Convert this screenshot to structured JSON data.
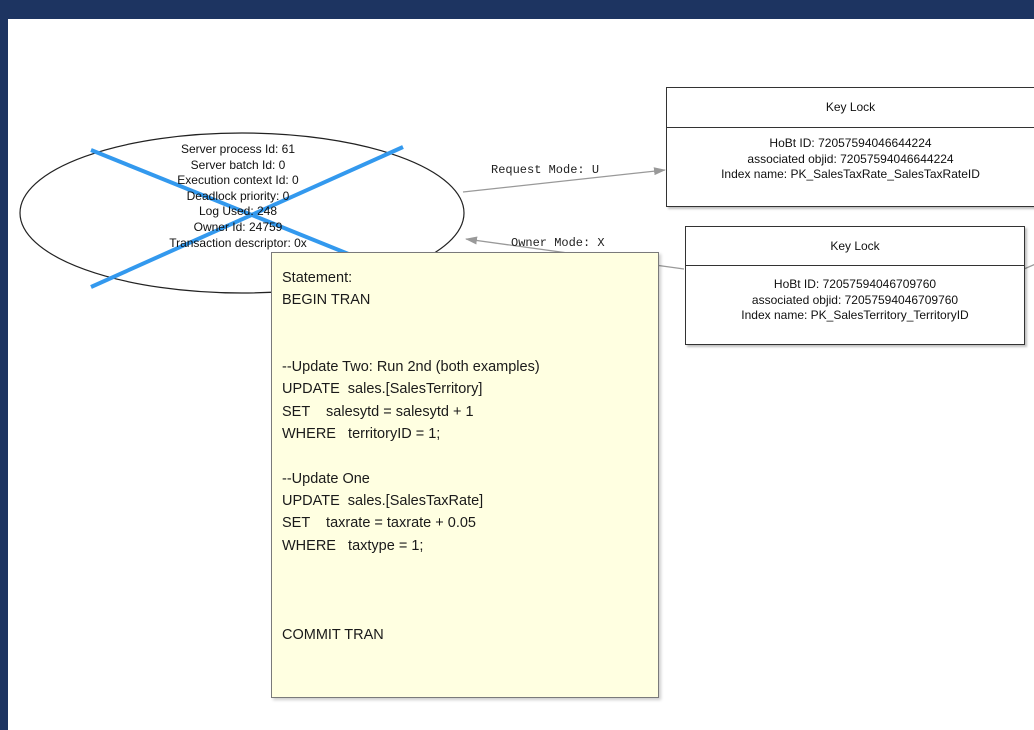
{
  "process": {
    "lines": [
      "Server process Id: 61",
      "Server batch Id: 0",
      "Execution context Id: 0",
      "Deadlock priority: 0",
      "Log Used: 248",
      "Owner Id: 24759",
      "Transaction descriptor: 0x"
    ],
    "victim_mark_color": "#3399ee"
  },
  "locks": [
    {
      "title": "Key Lock",
      "hobt": "HoBt ID: 72057594046644224",
      "objid": "associated objid: 72057594046644224",
      "index": "Index name: PK_SalesTaxRate_SalesTaxRateID"
    },
    {
      "title": "Key Lock",
      "hobt": "HoBt ID: 72057594046709760",
      "objid": "associated objid: 72057594046709760",
      "index": "Index name: PK_SalesTerritory_TerritoryID"
    }
  ],
  "edges": {
    "request": "Request Mode: U",
    "owner": "Owner Mode: X"
  },
  "tooltip": {
    "lines": [
      "Statement:",
      "BEGIN TRAN",
      "",
      "",
      "--Update Two: Run 2nd (both examples)",
      "UPDATE  sales.[SalesTerritory]",
      "SET    salesytd = salesytd + 1",
      "WHERE   territoryID = 1;",
      "",
      "--Update One",
      "UPDATE  sales.[SalesTaxRate]",
      "SET    taxrate = taxrate + 0.05",
      "WHERE   taxtype = 1;",
      "",
      "",
      "",
      "COMMIT TRAN"
    ]
  }
}
